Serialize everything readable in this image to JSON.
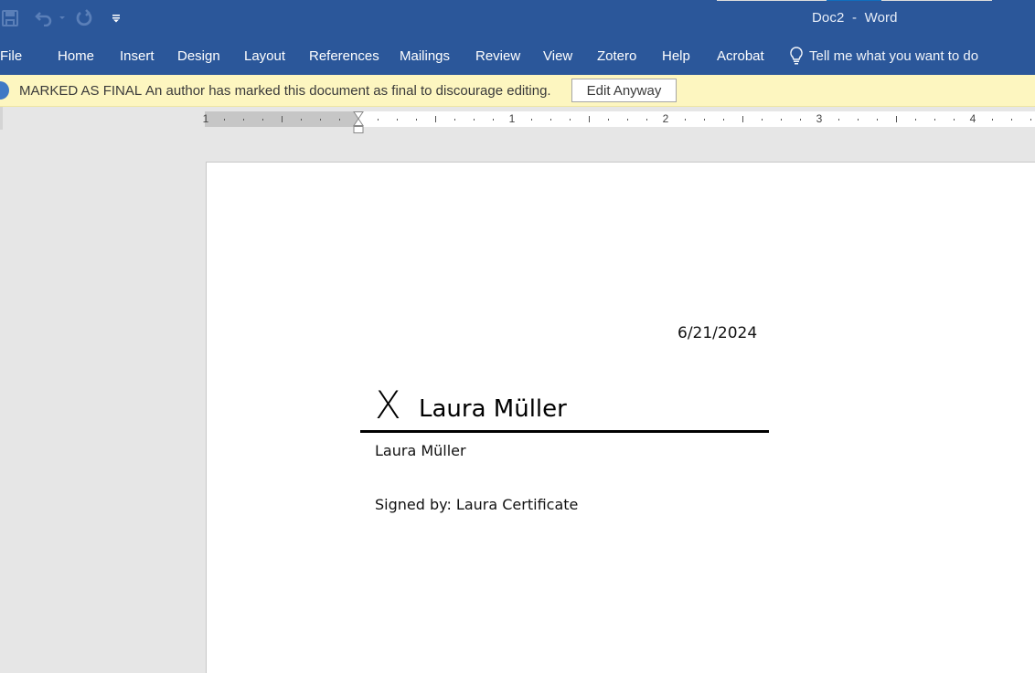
{
  "window": {
    "title": "Doc2  -  Word"
  },
  "quick_access": {
    "icons": [
      "save-icon",
      "undo-icon",
      "undo-dropdown-icon",
      "redo-icon",
      "customize-qat-icon"
    ]
  },
  "ribbon": {
    "tabs": [
      {
        "label": "File"
      },
      {
        "label": "Home"
      },
      {
        "label": "Insert"
      },
      {
        "label": "Design"
      },
      {
        "label": "Layout"
      },
      {
        "label": "References"
      },
      {
        "label": "Mailings"
      },
      {
        "label": "Review"
      },
      {
        "label": "View"
      },
      {
        "label": "Zotero"
      },
      {
        "label": "Help"
      },
      {
        "label": "Acrobat"
      }
    ],
    "tell_me": {
      "icon": "lightbulb-icon",
      "label": "Tell me what you want to do"
    }
  },
  "message_bar": {
    "icon": "info-icon",
    "title": "MARKED AS FINAL",
    "text": "An author has marked this document as final to discourage editing.",
    "button_label": "Edit Anyway"
  },
  "ruler": {
    "labels": [
      "1",
      "1",
      "2",
      "3",
      "4"
    ]
  },
  "document": {
    "date": "6/21/2024",
    "signature": {
      "x_mark": "X",
      "signed_name": "Laura Müller",
      "printed_name": "Laura Müller",
      "signed_by": "Signed by: Laura Certificate"
    }
  },
  "colors": {
    "title_bar": "#2b579a",
    "message_bar": "#fdf6c0",
    "page": "#ffffff",
    "workspace": "#e6e6e6"
  }
}
